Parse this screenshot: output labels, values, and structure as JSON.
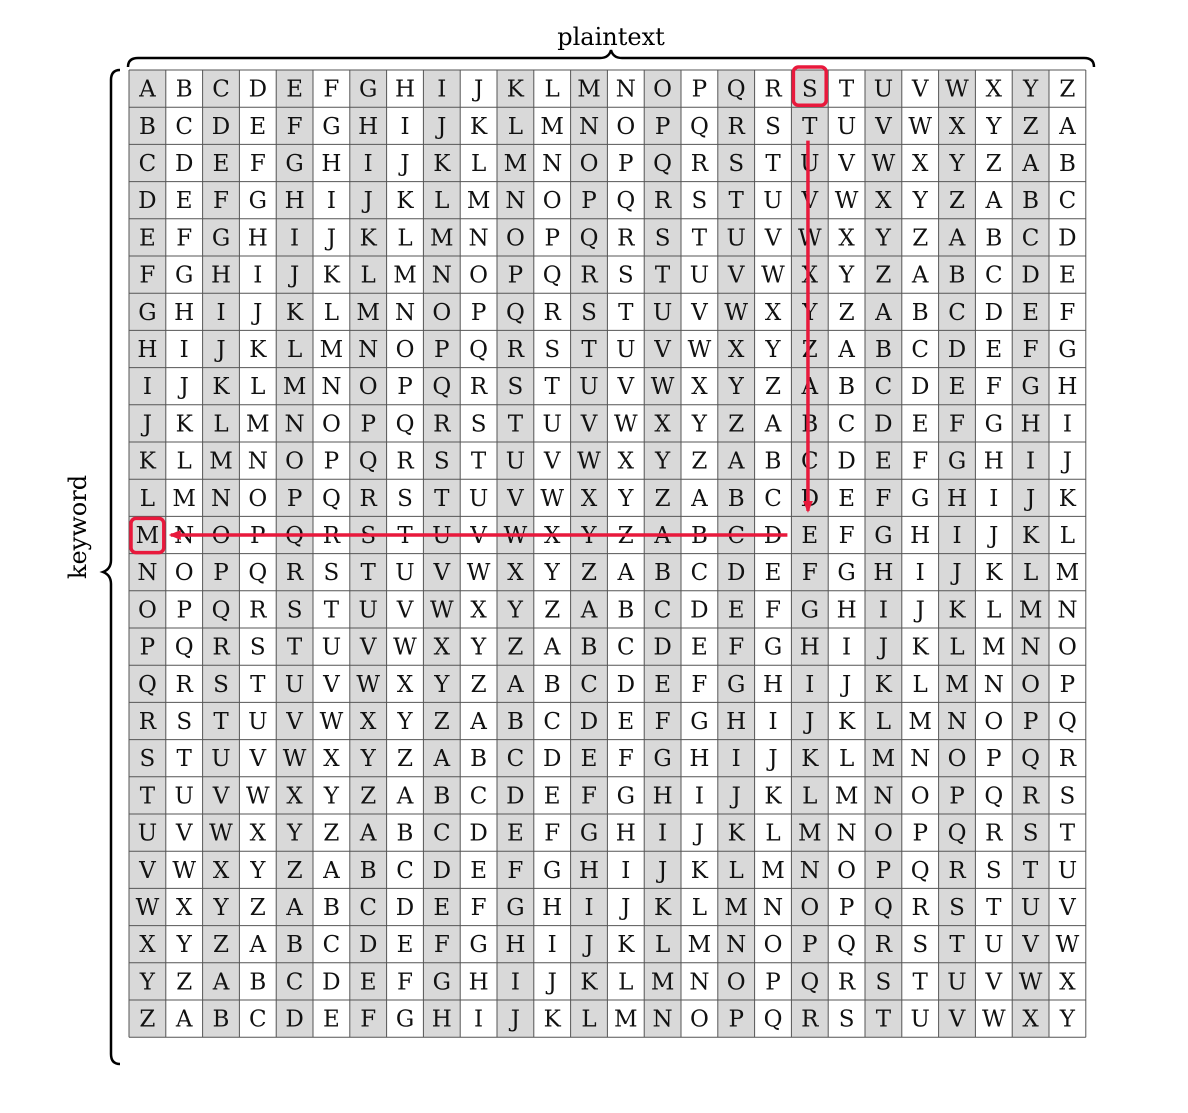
{
  "labels": {
    "top": "plaintext",
    "left": "keyword"
  },
  "alphabet": "ABCDEFGHIJKLMNOPQRSTUVWXYZ",
  "example": {
    "plaintext_letter": "S",
    "keyword_letter": "M",
    "ciphertext_letter": "E"
  },
  "colors": {
    "shade": "#d9d9d9",
    "grid": "#555555",
    "highlight": "#e8193c",
    "text": "#111111"
  }
}
